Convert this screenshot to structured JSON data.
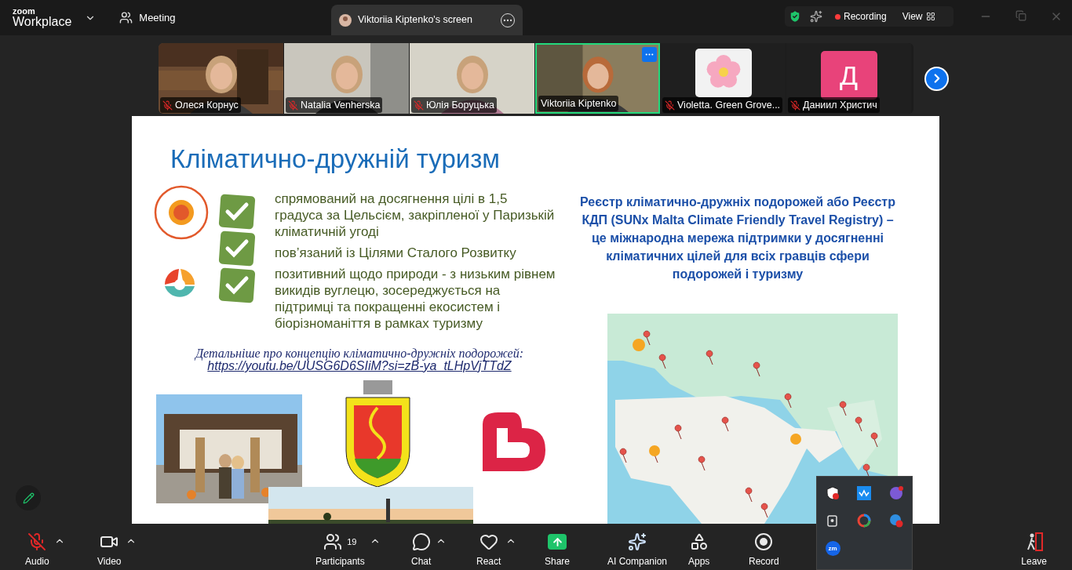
{
  "brand": {
    "top": "zoom",
    "name": "Workplace"
  },
  "meeting_label": "Meeting",
  "share_tab": {
    "title": "Viktoriia Kiptenko's screen"
  },
  "status": {
    "recording": "Recording",
    "view": "View"
  },
  "participants": [
    {
      "name": "Олеся Корнус",
      "kind": "video",
      "muted": true,
      "active": false
    },
    {
      "name": "Natalia Venherska",
      "kind": "video",
      "muted": true,
      "active": false
    },
    {
      "name": "Юлія Боруцька",
      "kind": "video",
      "muted": true,
      "active": false
    },
    {
      "name": "Viktoriia Kiptenko",
      "kind": "video",
      "muted": false,
      "active": true
    },
    {
      "name": "Violetta. Green Grove...",
      "muted": true,
      "active": false
    },
    {
      "name": "Даниил Христич",
      "kind": "initial",
      "initial": "Д",
      "muted": true,
      "active": false
    }
  ],
  "slide": {
    "title": "Кліматично-дружній туризм",
    "bullets": [
      "спрямований на досягнення цілі в 1,5 градуса за Цельсієм, закріпленої у Паризькій кліматичній угоді",
      "пов’язаний із Цілями Сталого Розвитку",
      "позитивний щодо природи - з низьким рівнем викидів вуглецю, зосереджується на підтримці та покращенні екосистем і біорізноманіття в рамках туризму"
    ],
    "link_caption": "Детальніше про концепцію кліматично-дружніх подорожей:",
    "link": "https://youtu.be/UUSG6D6SIiM?si=zB-ya_tLHpVjTTdZ",
    "registry_text": "Реєстр кліматично-дружніх подорожей або Реєстр КДП (SUNx Malta Climate Friendly Travel Registry) – це міжнародна мережа підтримки у досягненні кліматичних цілей для всіх гравців сфери подорожей і туризму"
  },
  "toolbar": [
    {
      "label": "Audio",
      "kind": "audio",
      "muted": true
    },
    {
      "label": "Video",
      "kind": "video"
    },
    {
      "label": "Participants",
      "kind": "participants",
      "count": "19"
    },
    {
      "label": "Chat",
      "kind": "chat"
    },
    {
      "label": "React",
      "kind": "react"
    },
    {
      "label": "Share",
      "kind": "share"
    },
    {
      "label": "AI Companion",
      "kind": "ai"
    },
    {
      "label": "Apps",
      "kind": "apps"
    },
    {
      "label": "Record",
      "kind": "record"
    }
  ],
  "leave": {
    "label": "Leave"
  },
  "tray": [
    {
      "kind": "shield"
    },
    {
      "kind": "waves"
    },
    {
      "kind": "viber"
    },
    {
      "kind": "camera"
    },
    {
      "kind": "ring"
    },
    {
      "kind": "badge"
    },
    {
      "kind": "zoom",
      "label": "zm"
    }
  ]
}
